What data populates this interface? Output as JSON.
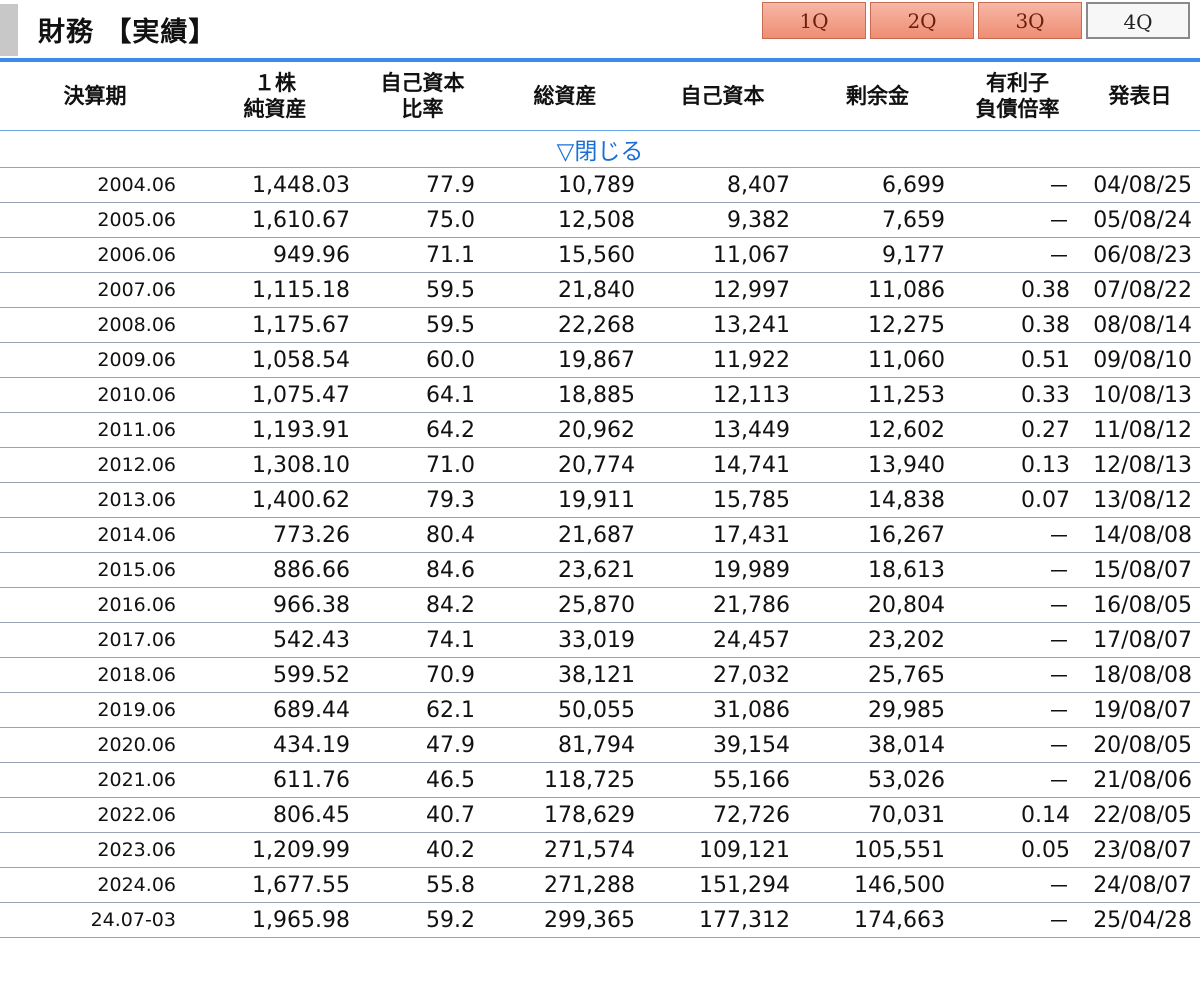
{
  "header": {
    "title": "財務 【実績】"
  },
  "quarter_tabs": [
    {
      "label": "1Q",
      "active": false
    },
    {
      "label": "2Q",
      "active": false
    },
    {
      "label": "3Q",
      "active": false
    },
    {
      "label": "4Q",
      "active": true
    }
  ],
  "table": {
    "columns": [
      {
        "line1": "決算期",
        "line2": ""
      },
      {
        "line1": "１株",
        "line2": "純資産"
      },
      {
        "line1": "自己資本",
        "line2": "比率"
      },
      {
        "line1": "総資産",
        "line2": ""
      },
      {
        "line1": "自己資本",
        "line2": ""
      },
      {
        "line1": "剰余金",
        "line2": ""
      },
      {
        "line1": "有利子",
        "line2": "負債倍率"
      },
      {
        "line1": "発表日",
        "line2": ""
      }
    ],
    "toggle_label": "▽閉じる",
    "rows": [
      [
        "2004.06",
        "1,448.03",
        "77.9",
        "10,789",
        "8,407",
        "6,699",
        "－",
        "04/08/25"
      ],
      [
        "2005.06",
        "1,610.67",
        "75.0",
        "12,508",
        "9,382",
        "7,659",
        "－",
        "05/08/24"
      ],
      [
        "2006.06",
        "949.96",
        "71.1",
        "15,560",
        "11,067",
        "9,177",
        "－",
        "06/08/23"
      ],
      [
        "2007.06",
        "1,115.18",
        "59.5",
        "21,840",
        "12,997",
        "11,086",
        "0.38",
        "07/08/22"
      ],
      [
        "2008.06",
        "1,175.67",
        "59.5",
        "22,268",
        "13,241",
        "12,275",
        "0.38",
        "08/08/14"
      ],
      [
        "2009.06",
        "1,058.54",
        "60.0",
        "19,867",
        "11,922",
        "11,060",
        "0.51",
        "09/08/10"
      ],
      [
        "2010.06",
        "1,075.47",
        "64.1",
        "18,885",
        "12,113",
        "11,253",
        "0.33",
        "10/08/13"
      ],
      [
        "2011.06",
        "1,193.91",
        "64.2",
        "20,962",
        "13,449",
        "12,602",
        "0.27",
        "11/08/12"
      ],
      [
        "2012.06",
        "1,308.10",
        "71.0",
        "20,774",
        "14,741",
        "13,940",
        "0.13",
        "12/08/13"
      ],
      [
        "2013.06",
        "1,400.62",
        "79.3",
        "19,911",
        "15,785",
        "14,838",
        "0.07",
        "13/08/12"
      ],
      [
        "2014.06",
        "773.26",
        "80.4",
        "21,687",
        "17,431",
        "16,267",
        "－",
        "14/08/08"
      ],
      [
        "2015.06",
        "886.66",
        "84.6",
        "23,621",
        "19,989",
        "18,613",
        "－",
        "15/08/07"
      ],
      [
        "2016.06",
        "966.38",
        "84.2",
        "25,870",
        "21,786",
        "20,804",
        "－",
        "16/08/05"
      ],
      [
        "2017.06",
        "542.43",
        "74.1",
        "33,019",
        "24,457",
        "23,202",
        "－",
        "17/08/07"
      ],
      [
        "2018.06",
        "599.52",
        "70.9",
        "38,121",
        "27,032",
        "25,765",
        "－",
        "18/08/08"
      ],
      [
        "2019.06",
        "689.44",
        "62.1",
        "50,055",
        "31,086",
        "29,985",
        "－",
        "19/08/07"
      ],
      [
        "2020.06",
        "434.19",
        "47.9",
        "81,794",
        "39,154",
        "38,014",
        "－",
        "20/08/05"
      ],
      [
        "2021.06",
        "611.76",
        "46.5",
        "118,725",
        "55,166",
        "53,026",
        "－",
        "21/08/06"
      ],
      [
        "2022.06",
        "806.45",
        "40.7",
        "178,629",
        "72,726",
        "70,031",
        "0.14",
        "22/08/05"
      ],
      [
        "2023.06",
        "1,209.99",
        "40.2",
        "271,574",
        "109,121",
        "105,551",
        "0.05",
        "23/08/07"
      ],
      [
        "2024.06",
        "1,677.55",
        "55.8",
        "271,288",
        "151,294",
        "146,500",
        "－",
        "24/08/07"
      ],
      [
        "24.07-03",
        "1,965.98",
        "59.2",
        "299,365",
        "177,312",
        "174,663",
        "－",
        "25/04/28"
      ]
    ]
  },
  "colors": {
    "accent_blue": "#3d8be8",
    "link_blue": "#1a6fd6",
    "tab_salmon": "#ef8d73"
  }
}
